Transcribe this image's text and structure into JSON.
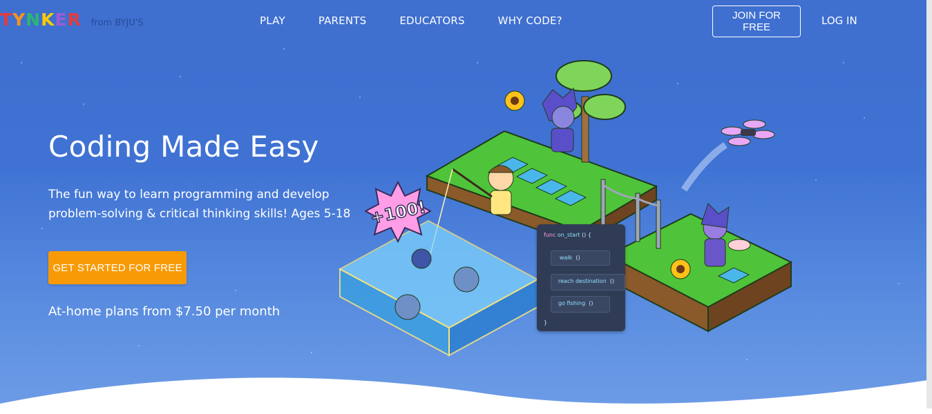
{
  "brand": {
    "logo_letters": [
      "T",
      "Y",
      "N",
      "K",
      "E",
      "R"
    ],
    "logo_colors": [
      "#e63b3b",
      "#f7931e",
      "#2bb673",
      "#ffcc00",
      "#a05bd6",
      "#e63b3b"
    ],
    "tagline": "from BYJU'S"
  },
  "nav": {
    "items": [
      "PLAY",
      "PARENTS",
      "EDUCATORS",
      "WHY CODE?"
    ],
    "join_label": "JOIN FOR FREE",
    "login_label": "LOG IN"
  },
  "hero": {
    "title": "Coding Made Easy",
    "subtitle": "The fun way to learn programming and develop problem-solving & critical thinking skills! Ages 5-18",
    "cta_label": "GET STARTED FOR FREE",
    "plans": "At-home plans from $7.50 per month"
  },
  "illustration": {
    "badge_text": "+100!",
    "code": {
      "line1_kw": "func",
      "line1_fn": "on_start",
      "line1_rest": "() {",
      "block1": "walk",
      "block1_args": "()",
      "block2": "reach destination",
      "block2_args": "()",
      "block3": "go fishing",
      "block3_args": "()",
      "close": "}"
    }
  },
  "colors": {
    "cta": "#f89a06",
    "background_top": "#3f6fcf",
    "background_bottom": "#6d9ce6"
  }
}
